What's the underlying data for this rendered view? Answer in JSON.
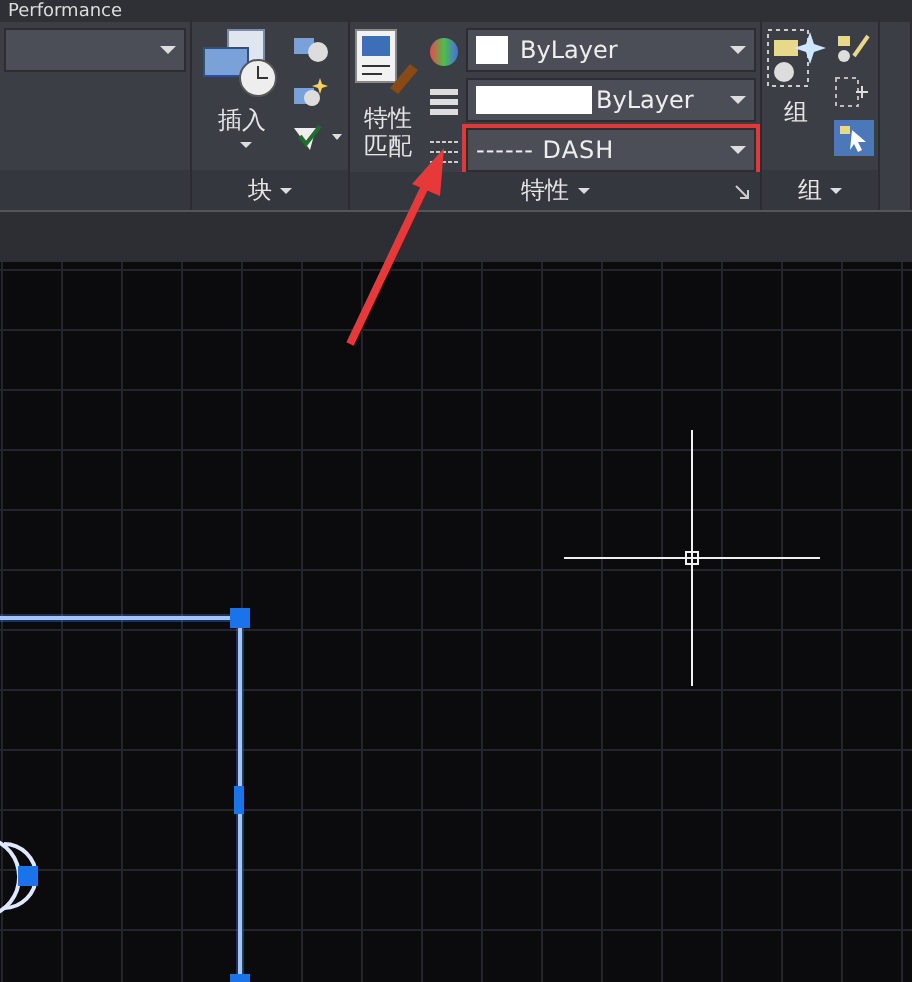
{
  "top_strip": {
    "title": "Performance"
  },
  "block_panel": {
    "insert_label": "插入",
    "label": "块"
  },
  "properties_panel": {
    "match_label": "特性匹配",
    "color": {
      "value": "ByLayer"
    },
    "lineweight": {
      "value": "ByLayer"
    },
    "linetype": {
      "value": "------ DASH",
      "highlighted": true
    },
    "label": "特性"
  },
  "group_panel": {
    "group_label": "组",
    "label": "组"
  }
}
